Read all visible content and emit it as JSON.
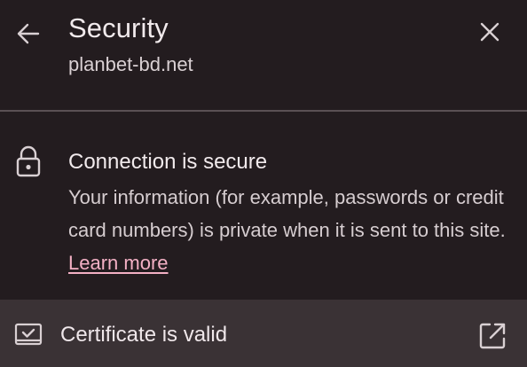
{
  "header": {
    "title": "Security",
    "site": "planbet-bd.net",
    "back_icon": "arrow-left-icon",
    "close_icon": "close-icon"
  },
  "connection": {
    "icon": "lock-icon",
    "title": "Connection is secure",
    "description_prefix": "Your information (for example, passwords or credit card numbers) is private when it is sent to this site.",
    "learn_more_label": "Learn more",
    "link_color": "#f3b0c4"
  },
  "certificate": {
    "icon": "certificate-icon",
    "label": "Certificate is valid",
    "action_icon": "external-link-icon"
  },
  "colors": {
    "background": "#231c1f",
    "row_background": "#3a3235",
    "text": "#ece4e6",
    "divider": "#5a5054"
  }
}
